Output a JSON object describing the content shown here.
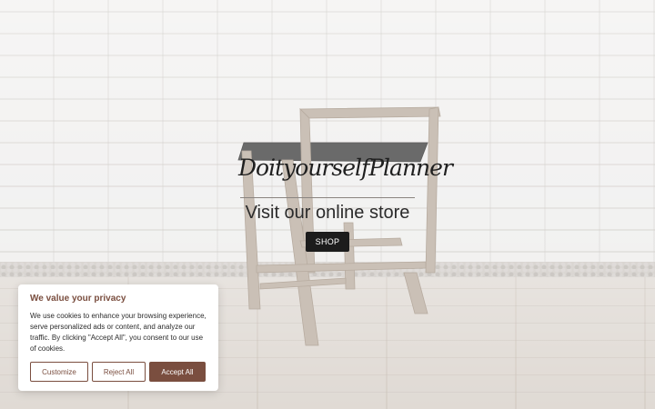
{
  "hero": {
    "brand": "DoityourselfPlanner",
    "tagline": "Visit our online store",
    "shop_label": "SHOP"
  },
  "cookie_banner": {
    "title": "We value your privacy",
    "message": "We use cookies to enhance your browsing experience, serve personalized ads or content, and analyze our traffic. By clicking \"Accept All\", you consent to our use of cookies.",
    "buttons": {
      "customize": "Customize",
      "reject": "Reject All",
      "accept": "Accept All"
    },
    "accent_color": "#7a4e3f"
  }
}
